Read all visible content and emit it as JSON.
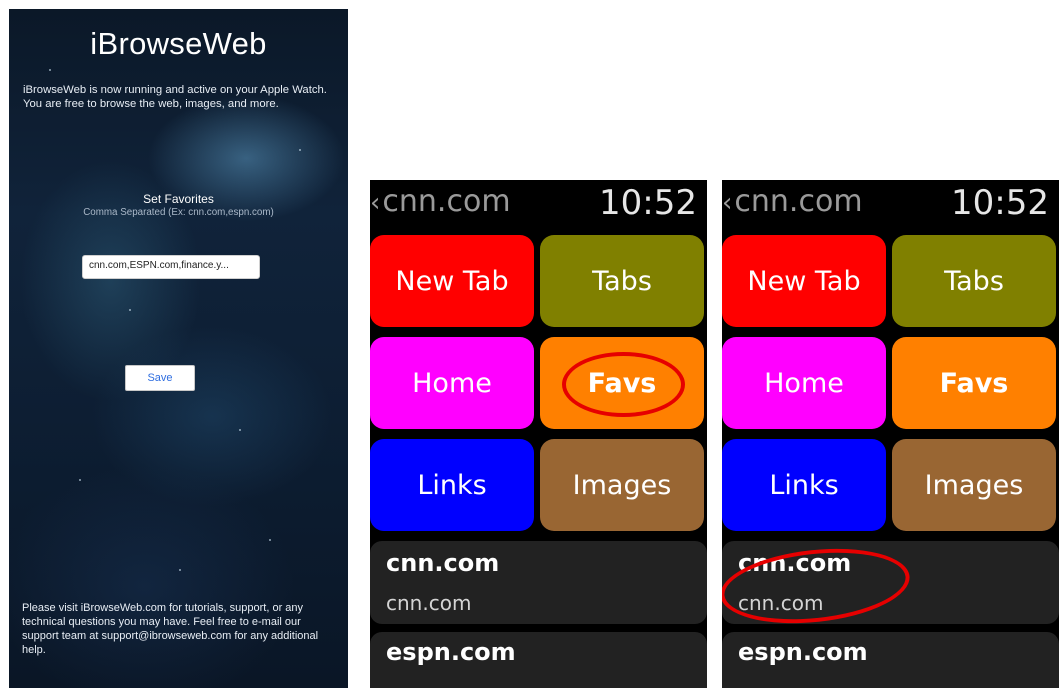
{
  "phone": {
    "title": "iBrowseWeb",
    "intro": "iBrowseWeb is now running and active on your Apple Watch. You are free to browse the web, images, and more.",
    "favorites_title": "Set Favorites",
    "favorites_hint": "Comma Separated (Ex: cnn.com,espn.com)",
    "favorites_value": "cnn.com,ESPN.com,finance.y...",
    "save_label": "Save",
    "footer": "Please visit iBrowseWeb.com for tutorials, support, or any technical questions you may have. Feel free to e-mail our support team at support@ibrowseweb.com for any additional help."
  },
  "watch_left": {
    "back_label": "cnn.com",
    "time": "10:52",
    "tiles": {
      "new_tab": "New Tab",
      "tabs": "Tabs",
      "home": "Home",
      "favs": "Favs",
      "links": "Links",
      "images": "Images"
    },
    "list": [
      {
        "title": "cnn.com",
        "subtitle": "cnn.com"
      },
      {
        "title": "espn.com"
      }
    ],
    "highlight": "favs-button"
  },
  "watch_right": {
    "back_label": "cnn.com",
    "time": "10:52",
    "tiles": {
      "new_tab": "New Tab",
      "tabs": "Tabs",
      "home": "Home",
      "favs": "Favs",
      "links": "Links",
      "images": "Images"
    },
    "list": [
      {
        "title": "cnn.com",
        "subtitle": "cnn.com"
      },
      {
        "title": "espn.com"
      }
    ],
    "highlight": "favorite-item-cnn"
  },
  "colors": {
    "new_tab": "#ff0000",
    "tabs": "#808000",
    "home": "#ff00ff",
    "favs": "#ff8000",
    "links": "#0000ff",
    "images": "#996633",
    "list_bg": "#222222",
    "highlight_circle": "#e60000"
  }
}
